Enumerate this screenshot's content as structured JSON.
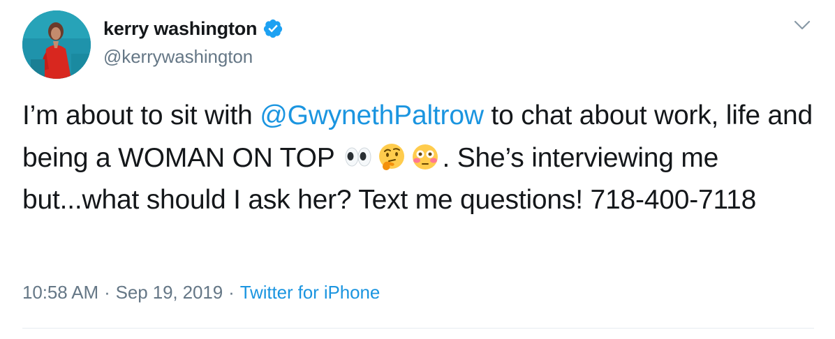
{
  "author": {
    "display_name": "kerry washington",
    "handle": "@kerrywashington",
    "verified": true
  },
  "tweet": {
    "text_1": "I’m about to sit with ",
    "mention": "@GwynethPaltrow",
    "text_2": " to chat about work, life and being a WOMAN ON TOP ",
    "emojis": [
      "eyes",
      "thinking-face",
      "flushed-face"
    ],
    "text_3": ". She’s interviewing me but...what should I ask her? Text me questions! 718-400-7118"
  },
  "meta": {
    "time": "10:58 AM",
    "separator": "·",
    "date": "Sep 19, 2019",
    "source": "Twitter for iPhone"
  },
  "colors": {
    "link": "#1b95e0",
    "muted": "#657786",
    "text": "#14171a",
    "verified": "#1da1f2"
  },
  "icons": {
    "verified": "verified-badge-icon",
    "caret": "chevron-down-icon"
  }
}
